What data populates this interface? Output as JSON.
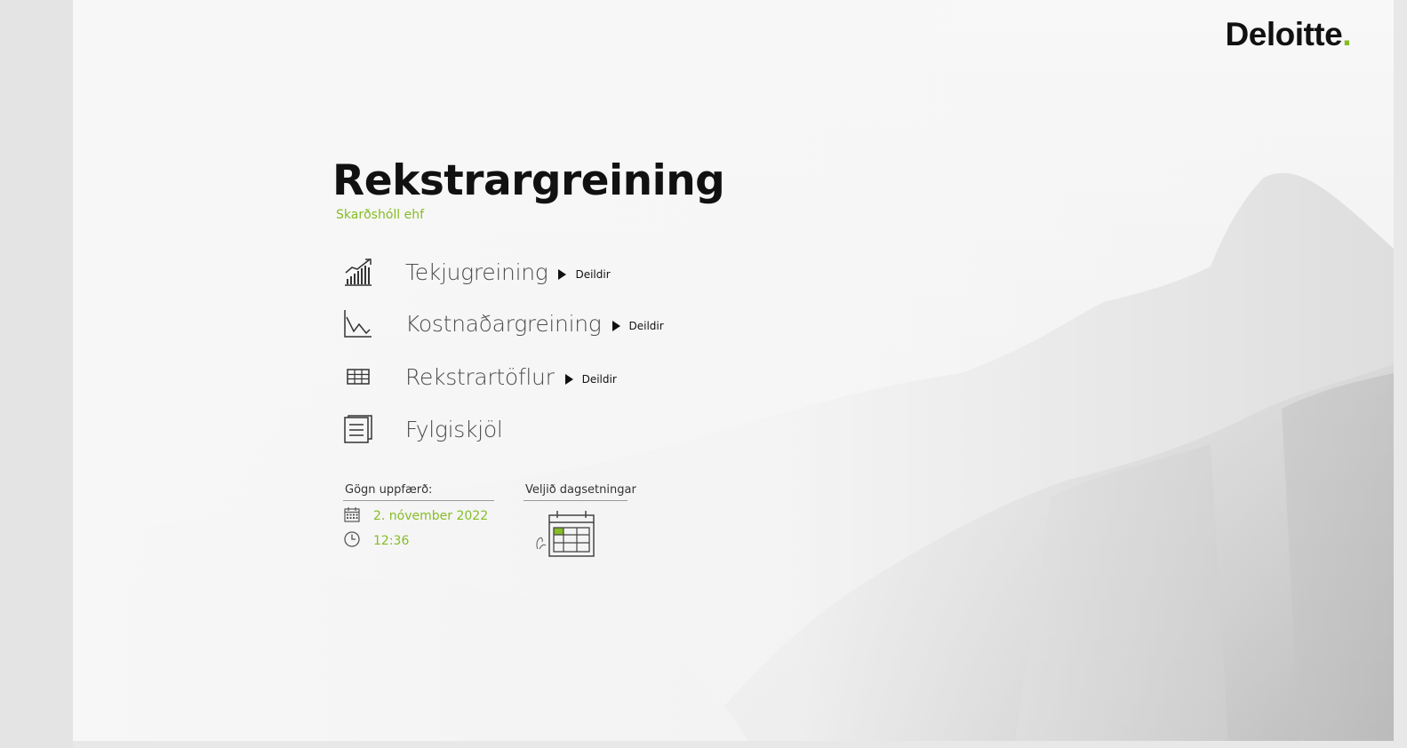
{
  "brand": {
    "name": "Deloitte",
    "dot": ".",
    "dot_color": "#86bc25"
  },
  "header": {
    "title": "Rekstrargreining",
    "company": "Skarðshóll ehf"
  },
  "nav": {
    "items": [
      {
        "label": "Tekjugreining",
        "icon": "revenue-chart-icon",
        "sub_label": "Deildir"
      },
      {
        "label": "Kostnaðargreining",
        "icon": "cost-chart-icon",
        "sub_label": "Deildir"
      },
      {
        "label": "Rekstrartöflur",
        "icon": "table-icon",
        "sub_label": "Deildir"
      },
      {
        "label": "Fylgiskjöl",
        "icon": "document-icon"
      }
    ]
  },
  "data_updated": {
    "heading": "Gögn uppfærð:",
    "date": "2. nóvember 2022",
    "time": "12:36",
    "date_icon": "calendar-icon",
    "time_icon": "clock-icon"
  },
  "date_picker": {
    "heading": "Veljið dagsetningar",
    "icon": "calendar-picker-icon"
  },
  "colors": {
    "accent": "#86bc25",
    "text": "#111111",
    "muted": "#4d4d4d"
  }
}
